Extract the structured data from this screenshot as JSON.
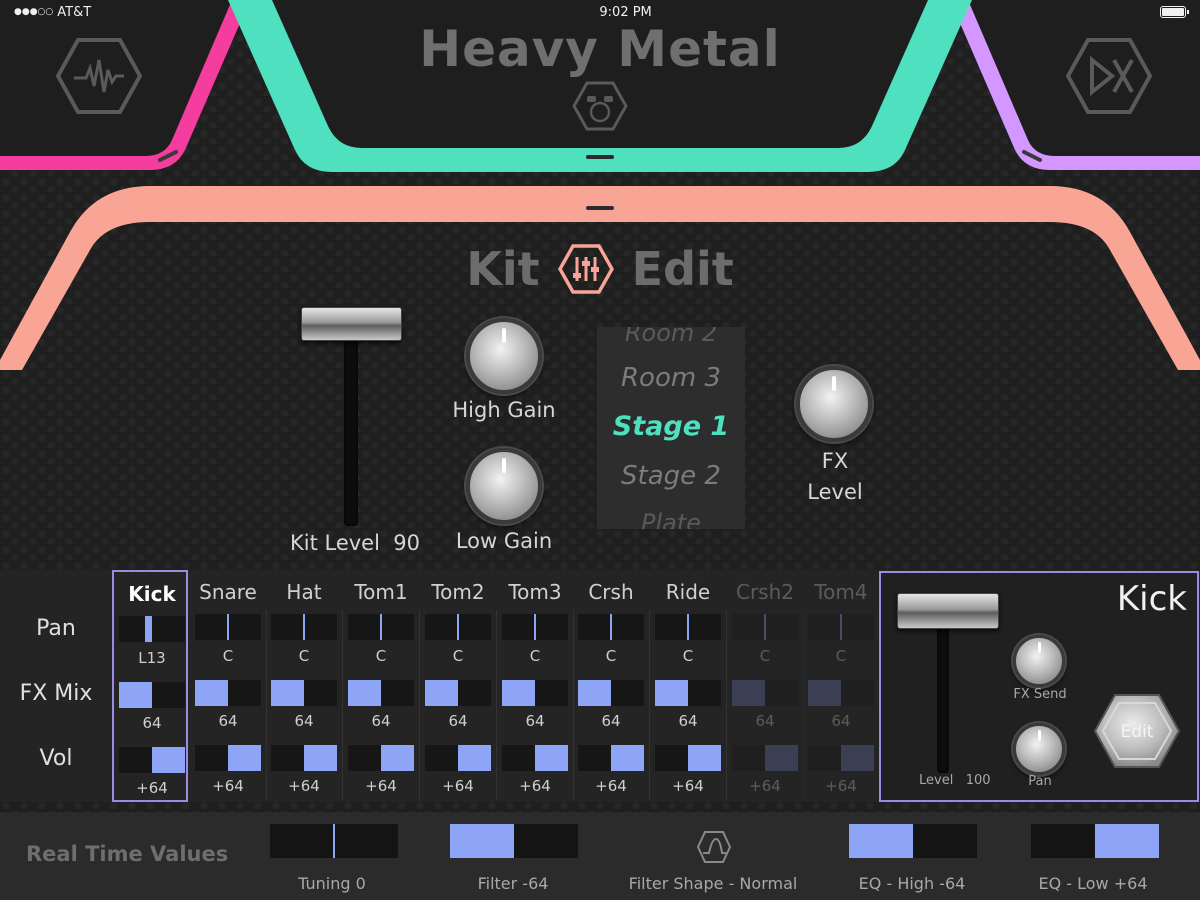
{
  "status": {
    "carrier": "AT&T",
    "time": "9:02 PM"
  },
  "kit": {
    "name": "Heavy Metal"
  },
  "header_icons": {
    "left": "waveform-icon",
    "center": "drum-kit-icon",
    "right": "dx-icon"
  },
  "colors": {
    "pink": "#f43d9e",
    "teal": "#4fe0c0",
    "purple": "#d397ff",
    "salmon": "#f9a595",
    "accent": "#8ea5f5",
    "selection": "#9a8de0",
    "picker_selected": "#4fe0c0"
  },
  "kit_edit": {
    "title_left": "Kit",
    "title_right": "Edit",
    "title_icon": "mixer-sliders-icon",
    "kit_level_label": "Kit Level",
    "kit_level_value": "90",
    "high_gain_label": "High Gain",
    "low_gain_label": "Low Gain",
    "fx_level_label_1": "FX",
    "fx_level_label_2": "Level",
    "reverb_picker": {
      "items": [
        "Room 2",
        "Room 3",
        "Stage 1",
        "Stage 2",
        "Plate"
      ],
      "selected": "Stage 1"
    }
  },
  "mixer": {
    "row_labels": {
      "pan": "Pan",
      "fx_mix": "FX Mix",
      "vol": "Vol"
    },
    "channels": [
      {
        "name": "Kick",
        "pan": "L13",
        "pan_value": -13,
        "fx_mix": "64",
        "fx_mix_fraction": 0.5,
        "vol": "+64",
        "vol_fraction": 1.0,
        "selected": true,
        "enabled": true
      },
      {
        "name": "Snare",
        "pan": "C",
        "pan_value": 0,
        "fx_mix": "64",
        "fx_mix_fraction": 0.5,
        "vol": "+64",
        "vol_fraction": 1.0,
        "enabled": true
      },
      {
        "name": "Hat",
        "pan": "C",
        "pan_value": 0,
        "fx_mix": "64",
        "fx_mix_fraction": 0.5,
        "vol": "+64",
        "vol_fraction": 1.0,
        "enabled": true
      },
      {
        "name": "Tom1",
        "pan": "C",
        "pan_value": 0,
        "fx_mix": "64",
        "fx_mix_fraction": 0.5,
        "vol": "+64",
        "vol_fraction": 1.0,
        "enabled": true
      },
      {
        "name": "Tom2",
        "pan": "C",
        "pan_value": 0,
        "fx_mix": "64",
        "fx_mix_fraction": 0.5,
        "vol": "+64",
        "vol_fraction": 1.0,
        "enabled": true
      },
      {
        "name": "Tom3",
        "pan": "C",
        "pan_value": 0,
        "fx_mix": "64",
        "fx_mix_fraction": 0.5,
        "vol": "+64",
        "vol_fraction": 1.0,
        "enabled": true
      },
      {
        "name": "Crsh",
        "pan": "C",
        "pan_value": 0,
        "fx_mix": "64",
        "fx_mix_fraction": 0.5,
        "vol": "+64",
        "vol_fraction": 1.0,
        "enabled": true
      },
      {
        "name": "Ride",
        "pan": "C",
        "pan_value": 0,
        "fx_mix": "64",
        "fx_mix_fraction": 0.5,
        "vol": "+64",
        "vol_fraction": 1.0,
        "enabled": true
      },
      {
        "name": "Crsh2",
        "pan": "C",
        "pan_value": 0,
        "fx_mix": "64",
        "fx_mix_fraction": 0.5,
        "vol": "+64",
        "vol_fraction": 1.0,
        "enabled": false
      },
      {
        "name": "Tom4",
        "pan": "C",
        "pan_value": 0,
        "fx_mix": "64",
        "fx_mix_fraction": 0.5,
        "vol": "+64",
        "vol_fraction": 1.0,
        "enabled": false
      }
    ]
  },
  "kick_panel": {
    "title": "Kick",
    "level_label": "Level",
    "level_value": "100",
    "fx_send_label": "FX Send",
    "pan_label": "Pan",
    "edit_label": "Edit"
  },
  "realtime": {
    "title": "Real Time Values",
    "controls": [
      {
        "label": "Tuning  0",
        "type": "center",
        "fraction": 0.5
      },
      {
        "label": "Filter -64",
        "type": "fill-left",
        "fraction": 0.5
      },
      {
        "label": "Filter Shape - Normal",
        "type": "icon",
        "icon": "filter-shape-icon"
      },
      {
        "label": "EQ - High  -64",
        "type": "fill-left",
        "fraction": 0.5
      },
      {
        "label": "EQ - Low  +64",
        "type": "fill-right",
        "fraction": 0.5
      }
    ]
  }
}
